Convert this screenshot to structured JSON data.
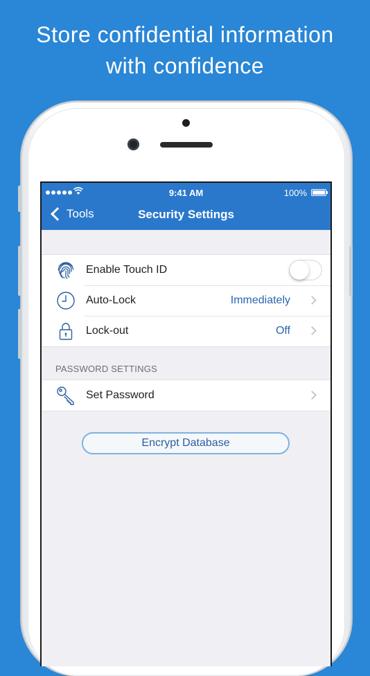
{
  "headline": {
    "line1": "Store confidential information",
    "line2": "with confidence"
  },
  "status_bar": {
    "time": "9:41 AM",
    "battery": "100%"
  },
  "nav": {
    "back_label": "Tools",
    "title": "Security Settings"
  },
  "security_rows": [
    {
      "icon": "fingerprint-icon",
      "label": "Enable Touch ID",
      "toggle": false
    },
    {
      "icon": "clock-icon",
      "label": "Auto-Lock",
      "value": "Immediately"
    },
    {
      "icon": "lock-icon",
      "label": "Lock-out",
      "value": "Off"
    }
  ],
  "password_section": {
    "header": "PASSWORD SETTINGS",
    "rows": [
      {
        "icon": "key-icon",
        "label": "Set Password"
      }
    ]
  },
  "encrypt_button": {
    "label": "Encrypt Database"
  },
  "colors": {
    "background": "#2a86d6",
    "nav_bar": "#2a78cc",
    "value_text": "#2a65b0"
  }
}
